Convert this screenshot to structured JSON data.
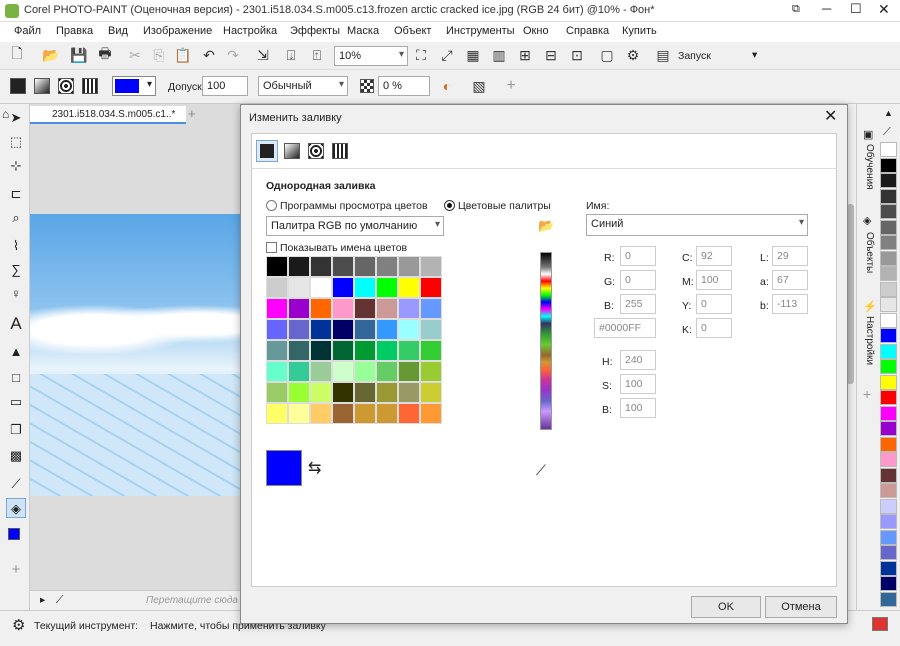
{
  "window": {
    "title": "Corel PHOTO-PAINT (Оценочная версия) - 2301.i518.034.S.m005.c13.frozen arctic cracked ice.jpg (RGB 24 бит) @10% - Фон*"
  },
  "menu": [
    "Файл",
    "Правка",
    "Вид",
    "Изображение",
    "Настройка",
    "Эффекты",
    "Маска",
    "Объект",
    "Инструменты",
    "Окно",
    "Справка",
    "Купить"
  ],
  "toolbar": {
    "zoom": "10%",
    "launch": "Запуск"
  },
  "propbar": {
    "tolerance_label": "Допуск:",
    "tolerance": "100",
    "mode": "Обычный",
    "transparency": "0 %"
  },
  "document": {
    "tab": "2301.i518.034.S.m005.c1..*",
    "drop_hint": "Перетащите сюда и"
  },
  "status": {
    "tool": "Текущий инструмент:",
    "hint": "Нажмите, чтобы применить заливку"
  },
  "dock": {
    "tabs": [
      "Обучения",
      "Объекты",
      "Настройки"
    ]
  },
  "dialog": {
    "title": "Изменить заливку",
    "section": "Однородная заливка",
    "radio_viewers": "Программы просмотра цветов",
    "radio_palettes": "Цветовые палитры",
    "palette_select": "Палитра RGB по умолчанию",
    "show_names": "Показывать имена цветов",
    "name_label": "Имя:",
    "name_value": "Синий",
    "rgb": {
      "r_label": "R:",
      "r": "0",
      "g_label": "G:",
      "g": "0",
      "b_label": "B:",
      "b": "255",
      "hex": "#0000FF"
    },
    "cmyk": {
      "c_label": "C:",
      "c": "92",
      "m_label": "M:",
      "m": "100",
      "y_label": "Y:",
      "y": "0",
      "k_label": "K:",
      "k": "0"
    },
    "lab": {
      "l_label": "L:",
      "l": "29",
      "a_label": "a:",
      "a": "67",
      "b_label": "b:",
      "b": "-113"
    },
    "hsb": {
      "h_label": "H:",
      "h": "240",
      "s_label": "S:",
      "s": "100",
      "b_label": "B:",
      "b": "100"
    },
    "ok": "OK",
    "cancel": "Отмена",
    "current_color": "#0000FF"
  },
  "colors": {
    "grid": [
      "#000000",
      "#1a1a1a",
      "#333333",
      "#4d4d4d",
      "#666666",
      "#808080",
      "#999999",
      "#b3b3b3",
      "#cccccc",
      "#e6e6e6",
      "#ffffff",
      "#0000ff",
      "#00ffff",
      "#00ff00",
      "#ffff00",
      "#ff0000",
      "#ff00ff",
      "#9900cc",
      "#ff6600",
      "#ff99cc",
      "#663333",
      "#cc9999",
      "#9999ff",
      "#6699ff",
      "#6666ff",
      "#6666cc",
      "#003399",
      "#000066",
      "#336699",
      "#3399ff",
      "#99ffff",
      "#99cccc",
      "#669999",
      "#336666",
      "#003333",
      "#006633",
      "#009933",
      "#00cc66",
      "#33cc66",
      "#33cc33",
      "#66ffcc",
      "#33cc99",
      "#99cc99",
      "#ccffcc",
      "#99ff99",
      "#66cc66",
      "#669933",
      "#99cc33",
      "#99cc66",
      "#99ff33",
      "#ccff66",
      "#333300",
      "#666633",
      "#999933",
      "#999966",
      "#cccc33",
      "#ffff66",
      "#ffff99",
      "#ffcc66",
      "#996633",
      "#cc9933",
      "#cc9933",
      "#ff6633",
      "#ff9933"
    ],
    "side_palette": [
      "#ffffff",
      "#000000",
      "#1a1a1a",
      "#333333",
      "#4d4d4d",
      "#666666",
      "#808080",
      "#999999",
      "#b3b3b3",
      "#cccccc",
      "#e6e6e6",
      "#ffffff",
      "#0000ff",
      "#00ffff",
      "#00ff00",
      "#ffff00",
      "#ff0000",
      "#ff00ff",
      "#9900cc",
      "#ff6600",
      "#ff99cc",
      "#663333",
      "#cc9999",
      "#ccccff",
      "#9999ff",
      "#6699ff",
      "#6666cc",
      "#003399",
      "#000066",
      "#336699"
    ]
  }
}
